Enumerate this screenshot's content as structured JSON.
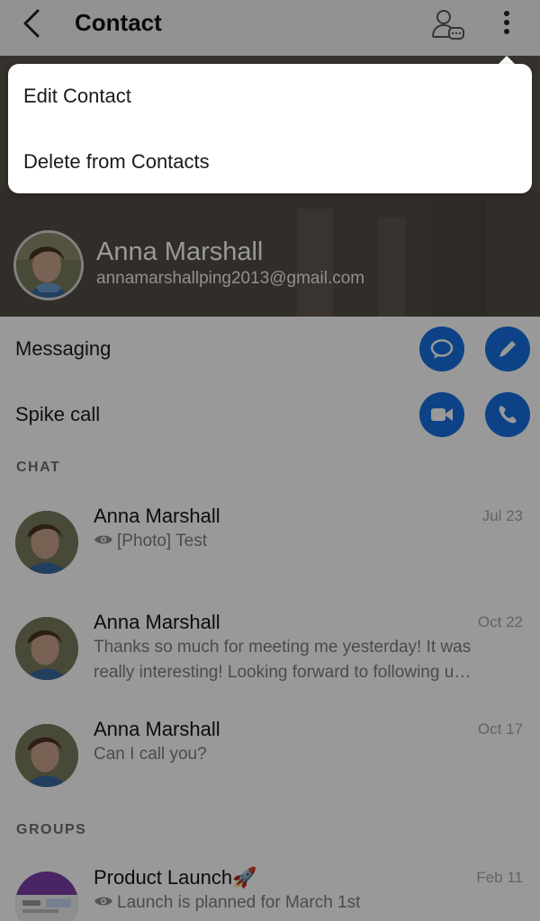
{
  "header": {
    "title": "Contact",
    "back_icon": "chevron-left-icon",
    "contact_icon": "person-chat-icon",
    "more_icon": "vertical-ellipsis-icon"
  },
  "profile": {
    "name": "Anna Marshall",
    "email": "annamarshallping2013@gmail.com"
  },
  "actions": [
    {
      "label": "Messaging",
      "buttons": [
        "chat-bubble-icon",
        "pencil-icon"
      ]
    },
    {
      "label": "Spike call",
      "buttons": [
        "video-camera-icon",
        "phone-icon"
      ]
    }
  ],
  "chat": {
    "section_title": "CHAT",
    "items": [
      {
        "name": "Anna Marshall",
        "date": "Jul 23",
        "preview": "[Photo] Test",
        "has_eye": true
      },
      {
        "name": "Anna Marshall",
        "date": "Oct 22",
        "preview_line1": "Thanks so much for meeting me yesterday! It was",
        "preview_line2": "really interesting! Looking forward to following u…"
      },
      {
        "name": "Anna Marshall",
        "date": "Oct 17",
        "preview": "Can I call you?"
      }
    ]
  },
  "groups": {
    "section_title": "GROUPS",
    "items": [
      {
        "name": "Product Launch🚀",
        "date": "Feb 11",
        "preview": "Launch is planned for March 1st",
        "has_eye": true
      }
    ]
  },
  "menu": {
    "items": [
      "Edit Contact",
      "Delete from Contacts"
    ]
  },
  "colors": {
    "accent": "#1770e0",
    "overlay": "rgba(0,0,0,0.40)"
  }
}
